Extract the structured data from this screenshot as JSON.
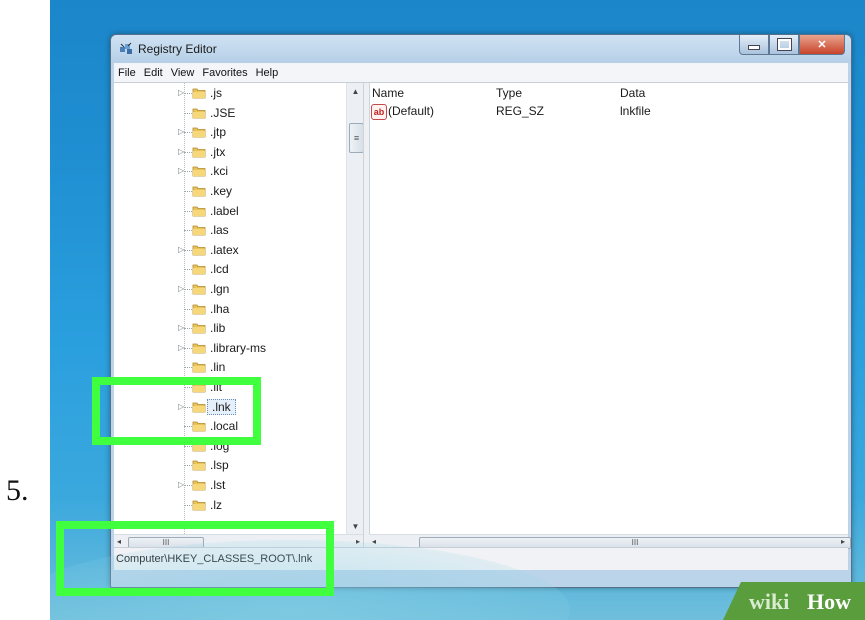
{
  "step_number": "5.",
  "window": {
    "title": "Registry Editor"
  },
  "menu": [
    "File",
    "Edit",
    "View",
    "Favorites",
    "Help"
  ],
  "tree": {
    "items": [
      {
        "label": ".js",
        "expandable": true
      },
      {
        "label": ".JSE",
        "expandable": false
      },
      {
        "label": ".jtp",
        "expandable": true
      },
      {
        "label": ".jtx",
        "expandable": true
      },
      {
        "label": ".kci",
        "expandable": true
      },
      {
        "label": ".key",
        "expandable": false
      },
      {
        "label": ".label",
        "expandable": false
      },
      {
        "label": ".las",
        "expandable": false
      },
      {
        "label": ".latex",
        "expandable": true
      },
      {
        "label": ".lcd",
        "expandable": false
      },
      {
        "label": ".lgn",
        "expandable": true
      },
      {
        "label": ".lha",
        "expandable": false
      },
      {
        "label": ".lib",
        "expandable": true
      },
      {
        "label": ".library-ms",
        "expandable": true
      },
      {
        "label": ".lin",
        "expandable": false
      },
      {
        "label": ".lit",
        "expandable": false
      },
      {
        "label": ".lnk",
        "expandable": true,
        "selected": true
      },
      {
        "label": ".local",
        "expandable": false
      },
      {
        "label": ".log",
        "expandable": false
      },
      {
        "label": ".lsp",
        "expandable": false
      },
      {
        "label": ".lst",
        "expandable": true
      },
      {
        "label": ".lz",
        "expandable": false
      }
    ],
    "scroll_thumb_glyph": "≡",
    "hscroll_thumb_glyph": "III"
  },
  "list": {
    "headers": {
      "name": "Name",
      "type": "Type",
      "data": "Data"
    },
    "rows": [
      {
        "icon": "ab",
        "name": "(Default)",
        "type": "REG_SZ",
        "data": "lnkfile"
      }
    ],
    "hscroll_thumb_glyph": "III"
  },
  "status": {
    "path": "Computer\\HKEY_CLASSES_ROOT\\.lnk"
  },
  "watermark": {
    "part1": "wiki",
    "part2": "How"
  }
}
